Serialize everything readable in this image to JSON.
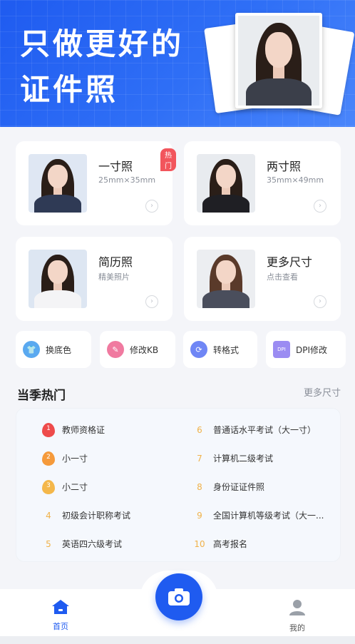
{
  "banner": {
    "line1": "只做更好的",
    "line2": "证件照"
  },
  "cards": [
    {
      "title": "一寸照",
      "sub": "25mm×35mm",
      "badge": "热门"
    },
    {
      "title": "两寸照",
      "sub": "35mm×49mm"
    },
    {
      "title": "简历照",
      "sub": "精美照片"
    },
    {
      "title": "更多尺寸",
      "sub": "点击查看"
    }
  ],
  "tools": [
    {
      "label": "换底色",
      "icon": "shirt-icon",
      "color": "#5aa9f0"
    },
    {
      "label": "修改KB",
      "icon": "file-edit-icon",
      "color": "#f07aa0"
    },
    {
      "label": "转格式",
      "icon": "convert-icon",
      "color": "#6f86f5"
    },
    {
      "label": "DPI修改",
      "icon": "dpi-icon",
      "color": "#9b8cf2"
    }
  ],
  "season": {
    "title": "当季热门",
    "more": "更多尺寸",
    "items": [
      {
        "rank": "1",
        "label": "教师资格证"
      },
      {
        "rank": "2",
        "label": "小一寸"
      },
      {
        "rank": "3",
        "label": "小二寸"
      },
      {
        "rank": "4",
        "label": "初级会计职称考试"
      },
      {
        "rank": "5",
        "label": "英语四六级考试"
      },
      {
        "rank": "6",
        "label": "普通话水平考试（大一寸）"
      },
      {
        "rank": "7",
        "label": "计算机二级考试"
      },
      {
        "rank": "8",
        "label": "身份证证件照"
      },
      {
        "rank": "9",
        "label": "全国计算机等级考试（大一..."
      },
      {
        "rank": "10",
        "label": "高考报名"
      }
    ]
  },
  "nav": {
    "home": "首页",
    "mine": "我的"
  },
  "colors": {
    "primary": "#1f5bf0",
    "hot": "#f2555c",
    "rank": "#f0b24a"
  }
}
